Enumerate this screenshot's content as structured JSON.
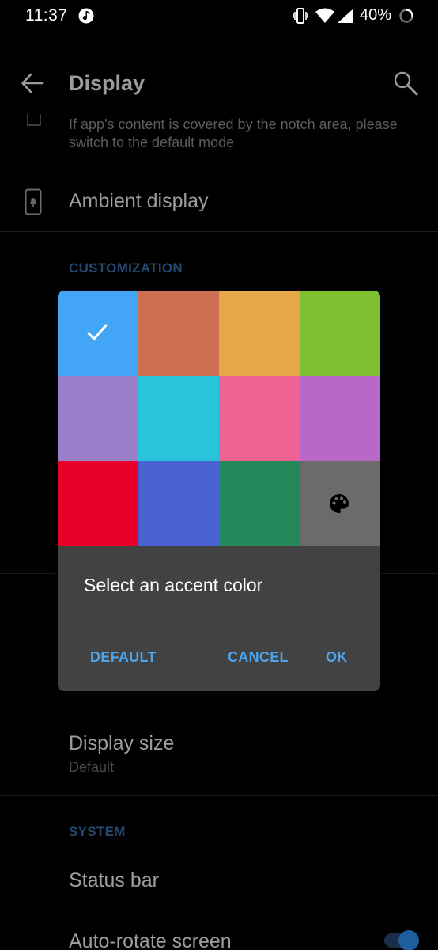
{
  "status_bar": {
    "time": "11:37",
    "battery_text": "40%",
    "icons": [
      "music-icon",
      "vibrate-icon",
      "wifi-icon",
      "signal-icon",
      "battery-icon"
    ]
  },
  "toolbar": {
    "title": "Display",
    "back_icon": "back-arrow-icon",
    "search_icon": "search-icon"
  },
  "background": {
    "notch_hint": "If app's content is covered by the notch area, please switch to the default mode",
    "ambient_display": "Ambient display",
    "customization_header": "CUSTOMIZATION",
    "display_size": {
      "title": "Display size",
      "subtitle": "Default"
    },
    "system_header": "SYSTEM",
    "status_bar_item": "Status bar",
    "auto_rotate_item": "Auto-rotate screen",
    "auto_rotate_on": true
  },
  "dialog": {
    "message": "Select an accent color",
    "buttons": {
      "default": "DEFAULT",
      "cancel": "CANCEL",
      "ok": "OK"
    },
    "swatches": [
      {
        "name": "swatch-blue",
        "color": "#42a5f5",
        "selected": true
      },
      {
        "name": "swatch-terracotta",
        "color": "#cd7052",
        "selected": false
      },
      {
        "name": "swatch-amber",
        "color": "#e6a749",
        "selected": false
      },
      {
        "name": "swatch-lime",
        "color": "#7dc030",
        "selected": false
      },
      {
        "name": "swatch-lavender",
        "color": "#9a7ec9",
        "selected": false
      },
      {
        "name": "swatch-cyan",
        "color": "#28c5da",
        "selected": false
      },
      {
        "name": "swatch-pink",
        "color": "#ef6394",
        "selected": false
      },
      {
        "name": "swatch-orchid",
        "color": "#b868c6",
        "selected": false
      },
      {
        "name": "swatch-red",
        "color": "#e8002a",
        "selected": false
      },
      {
        "name": "swatch-indigo",
        "color": "#4a63d4",
        "selected": false
      },
      {
        "name": "swatch-green",
        "color": "#23885a",
        "selected": false
      },
      {
        "name": "swatch-custom",
        "color": "#6b6b6b",
        "selected": false,
        "icon": "palette-icon"
      }
    ]
  },
  "colors": {
    "accent": "#4ea4ec",
    "dialog_bg": "#424242"
  }
}
